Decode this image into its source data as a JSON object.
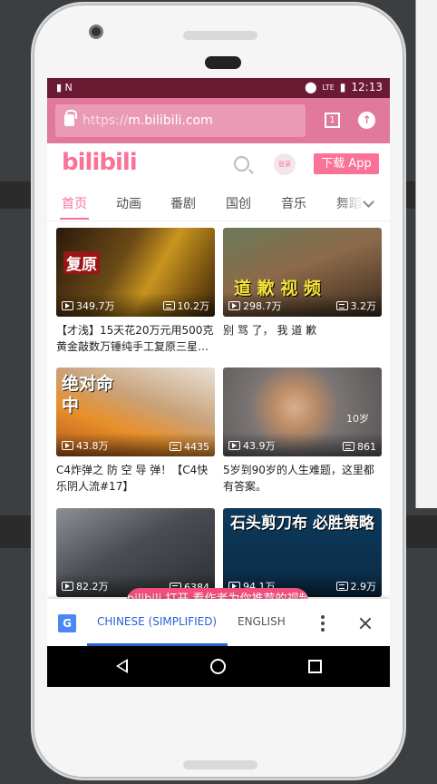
{
  "statusbar": {
    "time": "12:13",
    "network": "LTE"
  },
  "browser": {
    "url_scheme": "https://",
    "url_host": "m.bilibili.com",
    "tab_count": "1"
  },
  "header": {
    "logo": "bilibili",
    "login": "登录",
    "download": "下载 App"
  },
  "tabs": [
    {
      "label": "首页",
      "active": true
    },
    {
      "label": "动画"
    },
    {
      "label": "番剧"
    },
    {
      "label": "国创"
    },
    {
      "label": "音乐"
    },
    {
      "label": "舞蹈"
    }
  ],
  "videos": [
    {
      "views": "349.7万",
      "danmaku": "10.2万",
      "title": "【才浅】15天花20万元用500克黄金敲数万锤纯手工复原三星…",
      "overlay": "复原"
    },
    {
      "views": "298.7万",
      "danmaku": "3.2万",
      "title": "别 骂 了， 我 道 歉",
      "overlay": "道 歉 视 频"
    },
    {
      "views": "43.8万",
      "danmaku": "4435",
      "title": "C4炸弹之 防 空 导 弹！【C4快乐阴人流#17】",
      "overlay": "绝对命中"
    },
    {
      "views": "43.9万",
      "danmaku": "861",
      "title": "5岁到90岁的人生难题，这里都有答案。",
      "overlay": "10岁"
    },
    {
      "views": "82.2万",
      "danmaku": "6384",
      "title": "",
      "overlay": ""
    },
    {
      "views": "94.1万",
      "danmaku": "2.9万",
      "title": "",
      "overlay": "石头剪刀布 必胜策略"
    }
  ],
  "open_app_banner": "bilibili 打开 看作者为你推荐的视频",
  "translate": {
    "lang_a": "CHINESE (SIMPLIFIED)",
    "lang_b": "ENGLISH",
    "g": "G"
  },
  "colors": {
    "brand": "#fb7299",
    "urlbar": "#e0799b",
    "translate_accent": "#2a62d4"
  }
}
